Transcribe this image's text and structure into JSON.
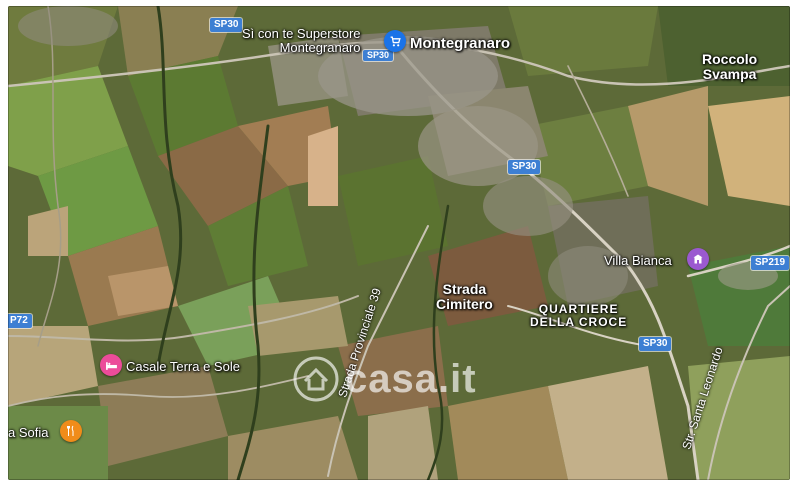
{
  "map": {
    "type": "satellite"
  },
  "labels": {
    "superstore": "Sì con te Superstore Montegranaro",
    "superstore_line1": "Sì con te Superstore",
    "superstore_line2": "Montegranaro",
    "montegranaro": "Montegranaro",
    "roccolo_line1": "Roccolo",
    "roccolo_line2": "Svampa",
    "villa_bianca": "Villa Bianca",
    "strada_line1": "Strada",
    "strada_line2": "Cimitero",
    "quartiere_line1": "QUARTIERE",
    "quartiere_line2": "DELLA CROCE",
    "casale": "Casale Terra e Sole",
    "sofia": "a Sofia",
    "strada_provinciale": "Strada Provinciale 39",
    "str_santa_leonardo": "Str. Santa Leonardo"
  },
  "shields": {
    "sp30_top": "SP30",
    "sp30_small": "SP30",
    "sp30_mid": "SP30",
    "sp30_low": "SP30",
    "sp219": "SP219",
    "sp72": "P72"
  },
  "icons": {
    "superstore": "shopping-cart-icon",
    "villa_bianca": "building-icon",
    "casale": "bed-icon",
    "sofia": "restaurant-icon"
  },
  "watermark": {
    "text": "casa.it"
  },
  "colors": {
    "pin_shopping": "#1a73e8",
    "pin_lodging": "#ec4c9a",
    "pin_landmark": "#9b59d0",
    "pin_food": "#f08c1a",
    "road_shield": "#3d7fd3"
  }
}
